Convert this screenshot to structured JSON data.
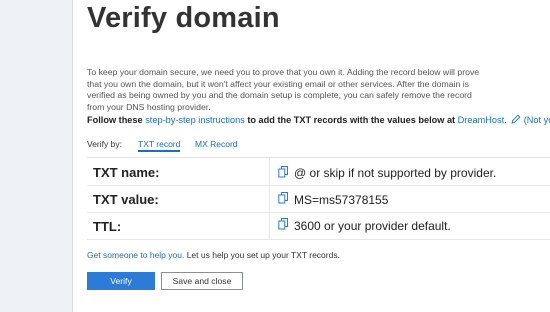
{
  "page": {
    "title": "Verify domain",
    "description": "To keep your domain secure, we need you to prove that you own it. Adding the record below will prove that you own the domain, but it won't affect your existing email or other services. After the domain is verified as being owned by you and the domain setup is complete, you can safely remove the record from your DNS hosting provider."
  },
  "instructions": {
    "prefix": "Follow these ",
    "link": "step-by-step instructions",
    "middle": " to add the TXT records with the values below at ",
    "host": "DreamHost.",
    "not_your": "(Not your"
  },
  "verify_by": {
    "label": "Verify by:",
    "tabs": [
      {
        "label": "TXT record",
        "active": true
      },
      {
        "label": "MX Record",
        "active": false
      }
    ]
  },
  "records": [
    {
      "label": "TXT name:",
      "value": "@ or skip if not supported by provider."
    },
    {
      "label": "TXT value:",
      "value": "MS=ms57378155"
    },
    {
      "label": "TTL:",
      "value": "3600 or your provider default."
    }
  ],
  "help": {
    "link": "Get someone to help you.",
    "text": " Let us help you set up your TXT records."
  },
  "buttons": {
    "verify": "Verify",
    "save_close": "Save and close"
  },
  "colors": {
    "accent": "#2c7bd6",
    "link": "#1a6ec3"
  }
}
